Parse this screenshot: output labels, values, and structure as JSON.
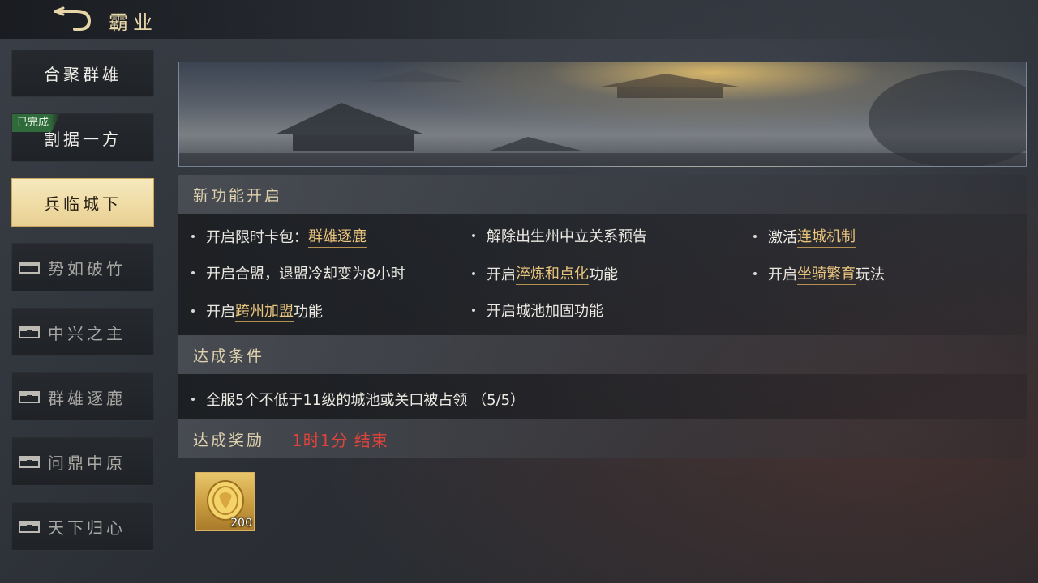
{
  "header": {
    "title": "霸业"
  },
  "sidebar": {
    "done_badge": "已完成",
    "items": [
      {
        "label": "合聚群雄"
      },
      {
        "label": "割据一方"
      },
      {
        "label": "兵临城下"
      },
      {
        "label": "势如破竹"
      },
      {
        "label": "中兴之主"
      },
      {
        "label": "群雄逐鹿"
      },
      {
        "label": "问鼎中原"
      },
      {
        "label": "天下归心"
      }
    ]
  },
  "features": {
    "title": "新功能开启",
    "items": [
      {
        "pre": "开启限时卡包：",
        "hl": "群雄逐鹿",
        "post": ""
      },
      {
        "pre": "解除出生州中立关系预告",
        "hl": "",
        "post": ""
      },
      {
        "pre": "激活",
        "hl": "连城机制",
        "post": ""
      },
      {
        "pre": "开启合盟，退盟冷却变为8小时",
        "hl": "",
        "post": ""
      },
      {
        "pre": "开启",
        "hl": "淬炼和点化",
        "post": "功能"
      },
      {
        "pre": "开启",
        "hl": "坐骑繁育",
        "post": "玩法"
      },
      {
        "pre": "开启",
        "hl": "跨州加盟",
        "post": "功能"
      },
      {
        "pre": "开启城池加固功能",
        "hl": "",
        "post": ""
      }
    ]
  },
  "conditions": {
    "title": "达成条件",
    "items": [
      {
        "text": "全服5个不低于11级的城池或关口被占领 （5/5）"
      }
    ]
  },
  "rewards": {
    "title": "达成奖励",
    "timer": "1时1分 结束",
    "items": [
      {
        "icon": "gold-coin-icon",
        "count": "200"
      }
    ]
  },
  "colors": {
    "accent": "#e9c47c",
    "timer": "#e0433b",
    "done": "#2f6b3a",
    "active": "#f3e2ae"
  }
}
